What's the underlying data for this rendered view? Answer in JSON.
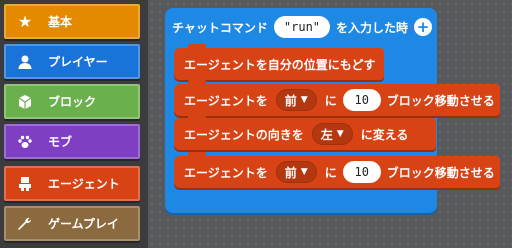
{
  "toolbox": {
    "categories": [
      {
        "label": "基本",
        "color": "#e58a00",
        "icon": "star-icon"
      },
      {
        "label": "プレイヤー",
        "color": "#1a73d9",
        "icon": "person-icon"
      },
      {
        "label": "ブロック",
        "color": "#6ab04c",
        "icon": "cube-icon"
      },
      {
        "label": "モブ",
        "color": "#7e3fc2",
        "icon": "paw-icon"
      },
      {
        "label": "エージェント",
        "color": "#d84315",
        "icon": "agent-icon"
      },
      {
        "label": "ゲームプレイ",
        "color": "#8c6a3f",
        "icon": "wrench-icon"
      }
    ]
  },
  "event_block": {
    "prefix": "チャットコマンド",
    "command_value": "\"run\"",
    "suffix": "を入力した時",
    "color": "#1e88e5"
  },
  "statements": [
    {
      "text": "エージェントを自分の位置にもどす"
    },
    {
      "before": "エージェントを",
      "dropdown": "前",
      "middle": "に",
      "number": "10",
      "after": "ブロック移動させる"
    },
    {
      "before": "エージェントの向きを",
      "dropdown": "左",
      "after": "に変える"
    },
    {
      "before": "エージェントを",
      "dropdown": "前",
      "middle": "に",
      "number": "10",
      "after": "ブロック移動させる"
    }
  ],
  "statement_color": "#d84315"
}
